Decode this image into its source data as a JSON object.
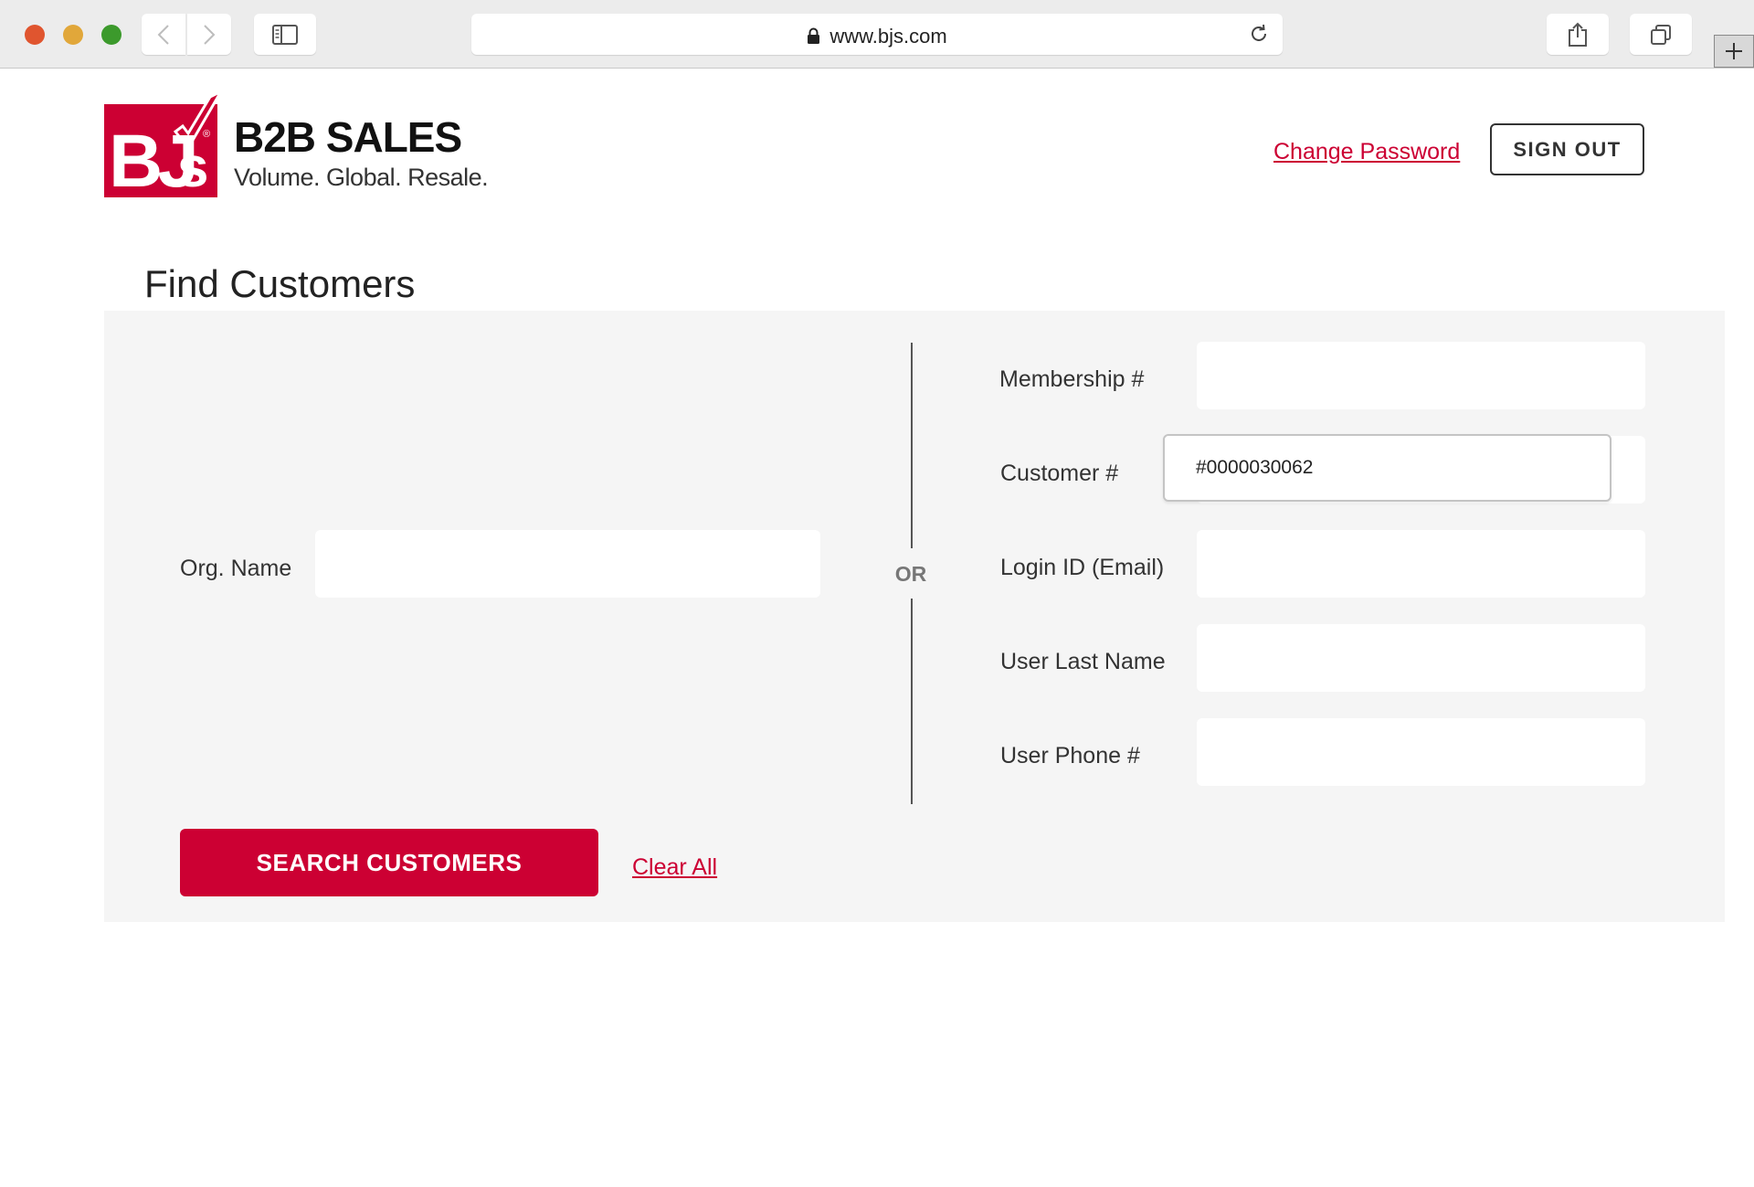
{
  "browser": {
    "url": "www.bjs.com"
  },
  "header": {
    "logo_text": "BJ's",
    "brand_title": "B2B SALES",
    "brand_tagline": "Volume. Global. Resale.",
    "change_password": "Change Password",
    "sign_out": "SIGN OUT"
  },
  "page": {
    "title": "Find Customers"
  },
  "search": {
    "org_name": {
      "label": "Org. Name",
      "value": ""
    },
    "separator": "OR",
    "membership": {
      "label": "Membership #",
      "value": ""
    },
    "customer": {
      "label": "Customer #",
      "value": "#0000030062"
    },
    "login_id": {
      "label": "Login ID (Email)",
      "value": ""
    },
    "last_name": {
      "label": "User Last Name",
      "value": ""
    },
    "phone": {
      "label": "User Phone #",
      "value": ""
    },
    "submit": "SEARCH CUSTOMERS",
    "clear": "Clear All"
  },
  "colors": {
    "brand_red": "#cc0033",
    "panel_bg": "#f5f5f5"
  }
}
